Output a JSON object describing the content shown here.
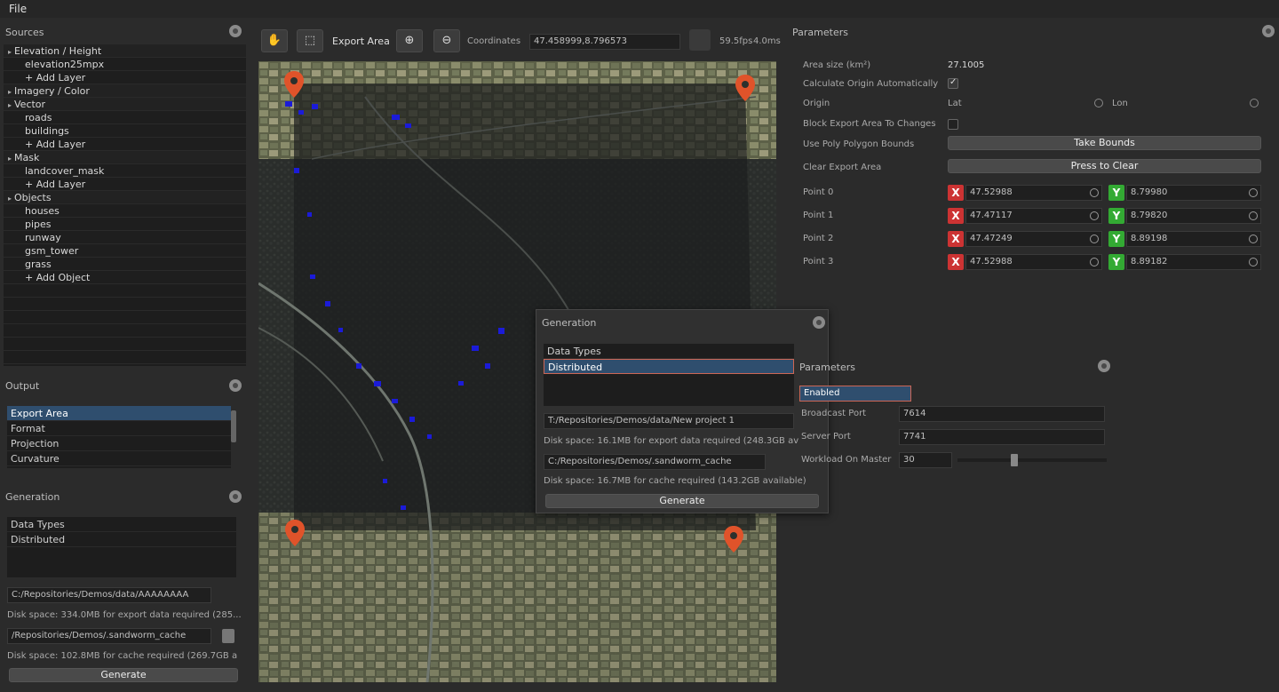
{
  "menu": {
    "file": "File"
  },
  "sources": {
    "title": "Sources",
    "rows": [
      {
        "kind": "cat",
        "label": "Elevation / Height"
      },
      {
        "kind": "child",
        "label": "elevation25mpx"
      },
      {
        "kind": "child",
        "label": "+ Add Layer"
      },
      {
        "kind": "cat",
        "label": "Imagery / Color"
      },
      {
        "kind": "cat",
        "label": "Vector"
      },
      {
        "kind": "child",
        "label": "roads"
      },
      {
        "kind": "child",
        "label": "buildings"
      },
      {
        "kind": "child",
        "label": "+ Add Layer"
      },
      {
        "kind": "cat",
        "label": "Mask"
      },
      {
        "kind": "child",
        "label": "landcover_mask"
      },
      {
        "kind": "child",
        "label": "+ Add Layer"
      },
      {
        "kind": "cat",
        "label": "Objects"
      },
      {
        "kind": "child",
        "label": "houses"
      },
      {
        "kind": "child",
        "label": "pipes"
      },
      {
        "kind": "child",
        "label": "runway"
      },
      {
        "kind": "child",
        "label": "gsm_tower"
      },
      {
        "kind": "child",
        "label": "grass"
      },
      {
        "kind": "child",
        "label": "+ Add Object"
      }
    ]
  },
  "output": {
    "title": "Output",
    "items": [
      "Export Area",
      "Format",
      "Projection",
      "Curvature"
    ],
    "selected": "Export Area"
  },
  "generation_left": {
    "title": "Generation",
    "list": [
      "Data Types",
      "Distributed"
    ],
    "export_path": "C:/Repositories/Demos/data/AAAAAAAA",
    "export_disk": "Disk space: 334.0MB for export data required (285...",
    "cache_path": "/Repositories/Demos/.sandworm_cache",
    "cache_disk": "Disk space: 102.8MB for cache required (269.7GB a",
    "generate": "Generate"
  },
  "toolbar": {
    "export_area": "Export Area",
    "coordinates_label": "Coordinates",
    "coordinates_value": "47.458999,8.796573",
    "fps": "59.5fps",
    "zoom": "4.0ms"
  },
  "parameters": {
    "title": "Parameters",
    "area_label": "Area size (km²)",
    "area_value": "27.1005",
    "calc_origin": "Calculate Origin Automatically",
    "origin_label": "Origin",
    "origin_lat": "Lat",
    "origin_lon": "Lon",
    "block_export": "Block Export Area To Changes",
    "use_poly": "Use Poly Polygon Bounds",
    "take_bounds": "Take Bounds",
    "clear_label": "Clear Export Area",
    "press_clear": "Press to Clear",
    "points": [
      {
        "label": "Point 0",
        "x": "47.52988",
        "y": "8.79980"
      },
      {
        "label": "Point 1",
        "x": "47.47117",
        "y": "8.79820"
      },
      {
        "label": "Point 2",
        "x": "47.47249",
        "y": "8.89198"
      },
      {
        "label": "Point 3",
        "x": "47.52988",
        "y": "8.89182"
      }
    ]
  },
  "gen_float": {
    "title": "Generation",
    "list": [
      "Data Types",
      "Distributed"
    ],
    "export_path": "T:/Repositories/Demos/data/New project 1",
    "export_disk": "Disk space: 16.1MB for export data required (248.3GB av",
    "cache_path": "C:/Repositories/Demos/.sandworm_cache",
    "cache_disk": "Disk space: 16.7MB for cache required (143.2GB available)",
    "generate": "Generate"
  },
  "dist_params": {
    "title": "Parameters",
    "mode": "Enabled",
    "broadcast_label": "Broadcast Port",
    "broadcast_value": "7614",
    "server_label": "Server Port",
    "server_value": "7741",
    "workload_label": "Workload On Master",
    "workload_value": "30",
    "workload_level": 0.36
  },
  "colors": {
    "accent": "#2f4e6e",
    "pin": "#e0532a",
    "x": "#c33",
    "y": "#3a3",
    "buildings": "#1b1bd8"
  },
  "icons": [
    "hand-pan-icon",
    "select-cursor-icon",
    "zoom-in-icon",
    "zoom-out-icon",
    "gear-icon",
    "map-pin-icon",
    "trash-icon",
    "refresh-icon"
  ]
}
